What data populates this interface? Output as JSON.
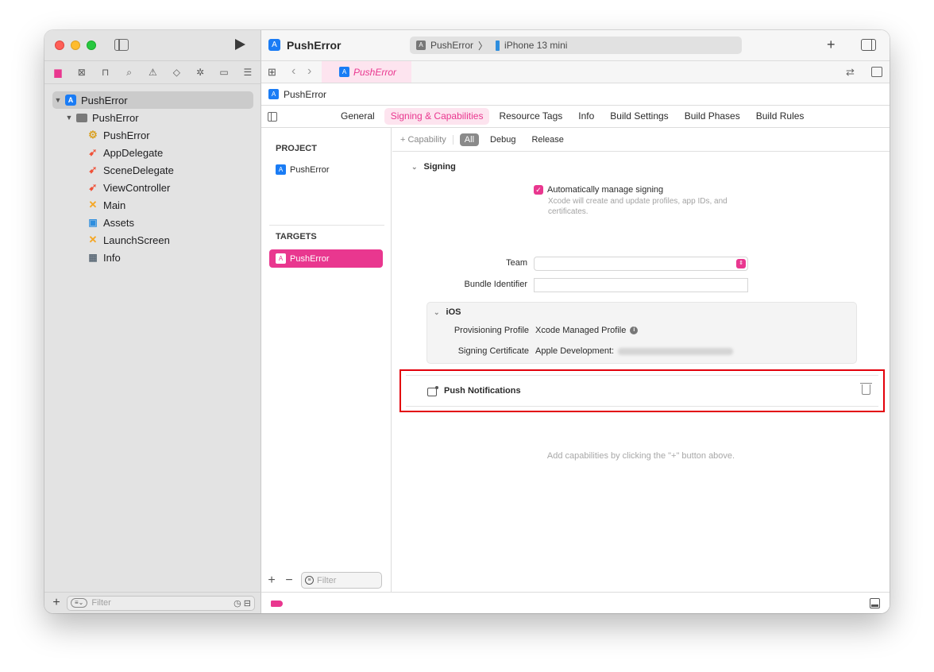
{
  "app": {
    "title": "PushError",
    "scheme_target": "PushError",
    "scheme_separator": "〉",
    "scheme_device": "iPhone 13 mini",
    "editor_tab": "PushError",
    "breadcrumb": "PushError",
    "accent_color": "#e9378f"
  },
  "navigator": {
    "icons": [
      "folder-icon",
      "source-control-icon",
      "hierarchy-icon",
      "search-icon",
      "warning-icon",
      "test-icon",
      "debug-icon",
      "breakpoint-icon",
      "report-icon"
    ],
    "tree": [
      {
        "label": "PushError",
        "icon": "app-icon",
        "level": 0,
        "expanded": true,
        "selected": true
      },
      {
        "label": "PushError",
        "icon": "folder-icon",
        "level": 1,
        "expanded": true
      },
      {
        "label": "PushError",
        "icon": "entitlements-icon",
        "level": 2
      },
      {
        "label": "AppDelegate",
        "icon": "swift-icon",
        "level": 2
      },
      {
        "label": "SceneDelegate",
        "icon": "swift-icon",
        "level": 2
      },
      {
        "label": "ViewController",
        "icon": "swift-icon",
        "level": 2
      },
      {
        "label": "Main",
        "icon": "storyboard-icon",
        "level": 2
      },
      {
        "label": "Assets",
        "icon": "assets-icon",
        "level": 2
      },
      {
        "label": "LaunchScreen",
        "icon": "storyboard-icon",
        "level": 2
      },
      {
        "label": "Info",
        "icon": "plist-icon",
        "level": 2
      }
    ],
    "filter_placeholder": "Filter"
  },
  "settings_tabs": [
    {
      "label": "General",
      "active": false
    },
    {
      "label": "Signing & Capabilities",
      "active": true
    },
    {
      "label": "Resource Tags",
      "active": false
    },
    {
      "label": "Info",
      "active": false
    },
    {
      "label": "Build Settings",
      "active": false
    },
    {
      "label": "Build Phases",
      "active": false
    },
    {
      "label": "Build Rules",
      "active": false
    }
  ],
  "project_list": {
    "project_header": "PROJECT",
    "project_item": "PushError",
    "targets_header": "TARGETS",
    "target_item": "PushError",
    "filter_placeholder": "Filter"
  },
  "editor": {
    "capability_button": "+ Capability",
    "segments": [
      "All",
      "Debug",
      "Release"
    ],
    "active_segment": "All",
    "signing": {
      "section_title": "Signing",
      "auto_manage_label": "Automatically manage signing",
      "auto_manage_checked": true,
      "auto_manage_desc": "Xcode will create and update profiles, app IDs, and certificates.",
      "team_label": "Team",
      "team_value": "",
      "bundle_id_label": "Bundle Identifier",
      "bundle_id_value": ""
    },
    "ios": {
      "section_title": "iOS",
      "prov_profile_label": "Provisioning Profile",
      "prov_profile_value": "Xcode Managed Profile",
      "signing_cert_label": "Signing Certificate",
      "signing_cert_value": "Apple Development:"
    },
    "push": {
      "title": "Push Notifications",
      "highlight_color": "#e3000b"
    },
    "hint": "Add capabilities by clicking the \"+\" button above."
  }
}
